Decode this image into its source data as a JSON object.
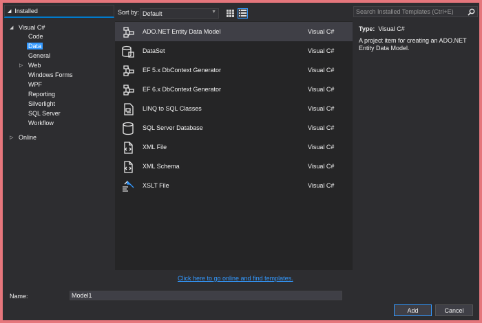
{
  "tree": {
    "header": "Installed",
    "items": [
      {
        "label": "Visual C#",
        "level": 0,
        "expanded": true
      },
      {
        "label": "Code",
        "level": 1
      },
      {
        "label": "Data",
        "level": 1,
        "selected": true
      },
      {
        "label": "General",
        "level": 1
      },
      {
        "label": "Web",
        "level": 1,
        "collapsed": true
      },
      {
        "label": "Windows Forms",
        "level": 1
      },
      {
        "label": "WPF",
        "level": 1
      },
      {
        "label": "Reporting",
        "level": 1
      },
      {
        "label": "Silverlight",
        "level": 1
      },
      {
        "label": "SQL Server",
        "level": 1
      },
      {
        "label": "Workflow",
        "level": 1
      },
      {
        "label": "Online",
        "level": 0,
        "collapsed": true
      }
    ]
  },
  "toolbar": {
    "sort_label": "Sort by:",
    "sort_value": "Default"
  },
  "templates": [
    {
      "name": "ADO.NET Entity Data Model",
      "lang": "Visual C#",
      "icon": "entity-model-icon"
    },
    {
      "name": "DataSet",
      "lang": "Visual C#",
      "icon": "dataset-icon"
    },
    {
      "name": "EF 5.x DbContext Generator",
      "lang": "Visual C#",
      "icon": "entity-model-icon"
    },
    {
      "name": "EF 6.x DbContext Generator",
      "lang": "Visual C#",
      "icon": "entity-model-icon"
    },
    {
      "name": "LINQ to SQL Classes",
      "lang": "Visual C#",
      "icon": "linq-icon"
    },
    {
      "name": "SQL Server Database",
      "lang": "Visual C#",
      "icon": "database-icon"
    },
    {
      "name": "XML File",
      "lang": "Visual C#",
      "icon": "xml-file-icon"
    },
    {
      "name": "XML Schema",
      "lang": "Visual C#",
      "icon": "xml-schema-icon"
    },
    {
      "name": "XSLT File",
      "lang": "Visual C#",
      "icon": "xslt-icon"
    }
  ],
  "online_link": "Click here to go online and find templates.",
  "search": {
    "placeholder": "Search Installed Templates (Ctrl+E)"
  },
  "details": {
    "type_label": "Type:",
    "type_value": "Visual C#",
    "description": "A project item for creating an ADO.NET Entity Data Model."
  },
  "footer": {
    "name_label": "Name:",
    "name_value": "Model1",
    "add_label": "Add",
    "cancel_label": "Cancel"
  },
  "colors": {
    "accent": "#3399ff",
    "background": "#2d2d30",
    "list_bg": "#252526",
    "border_outer": "#e5767c"
  }
}
